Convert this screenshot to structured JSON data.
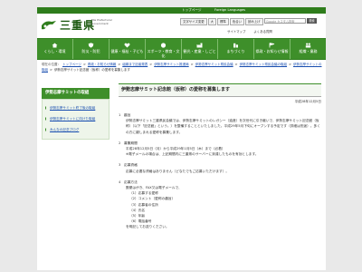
{
  "utility": {
    "home_page": "トップページ",
    "foreign_languages": "Foreign Languages"
  },
  "header": {
    "site_name": "三重県",
    "site_name_en": "Mie Prefectural Government",
    "buttons": [
      "文字サイズ変更",
      "大",
      "標準",
      "色合い",
      "読み上げ"
    ],
    "search_placeholder": "Google カスタム検索",
    "search_button": "検索",
    "links": [
      "サイトマップ",
      "よくある質問"
    ]
  },
  "nav": {
    "items": [
      "くらし・環境",
      "防災・防犯",
      "健康・福祉・子ども",
      "スポーツ・教育・文化",
      "観光・産業・しごと",
      "まちづくり",
      "県政・お知らせ情報",
      "組織・業務"
    ]
  },
  "breadcrumb": {
    "label": "現在の位置：",
    "items": [
      "トップページ",
      "県政・お知らせ情報",
      "組織まで記者発表",
      "伊勢志摩サミット推進局",
      "伊勢志摩サミット県民会議",
      "伊勢志摩サミット県民会議の取組",
      "伊勢志摩サミットの取組",
      "伊勢志摩サミット記念館（仮称）の愛称を募集します"
    ]
  },
  "sidebar": {
    "title": "伊勢志摩サミットの取組",
    "items": [
      "伊勢志摩サミット終了後の取組",
      "伊勢志摩サミットに向けた取組",
      "みんなの記念ブログ"
    ]
  },
  "article": {
    "title": "伊勢志摩サミット記念館（仮称）の愛称を募集します",
    "date": "平成28年12月5日",
    "section1_head": "1　趣旨",
    "section1_body": "伊勢志摩サミット三重県民会議では、伊勢志摩サミットのレガシー（遺産）を次世代に引き継いで、伊勢志摩サミット記念館（仮称）（以下「記念館」という。）を整備することといたしました。平成29年5月下旬にオープンする予定です（詳細は別途）。多くの方に親しまれる愛称を募集します。",
    "section2_head": "2　募集期間",
    "section2_body": "平成28年12月5日（月）から平成29年1月5日（木）まで（必着）",
    "section2_note": "※電子メールの場合は、上記期間内に三重県のサーバーに到達したものを有効とします。",
    "section3_head": "3　応募資格",
    "section3_body": "応募に必要な資格はありません（どなたでもご応募いただけます）。",
    "section4_head": "4　応募方法",
    "section4_body": "郵便はがき、FAX又は電子メールで、",
    "fields": [
      "（1）応募する愛称",
      "（2）コメント（愛称の趣旨）",
      "（3）応募者の住所",
      "（4）氏名",
      "（5）年齢",
      "（6）電話番号"
    ],
    "trailer": "を明記してお送りください。"
  },
  "colors": {
    "green_main": "#3e8f2a",
    "green_dark": "#2f7d1c",
    "link_blue": "#1a4fb0"
  }
}
